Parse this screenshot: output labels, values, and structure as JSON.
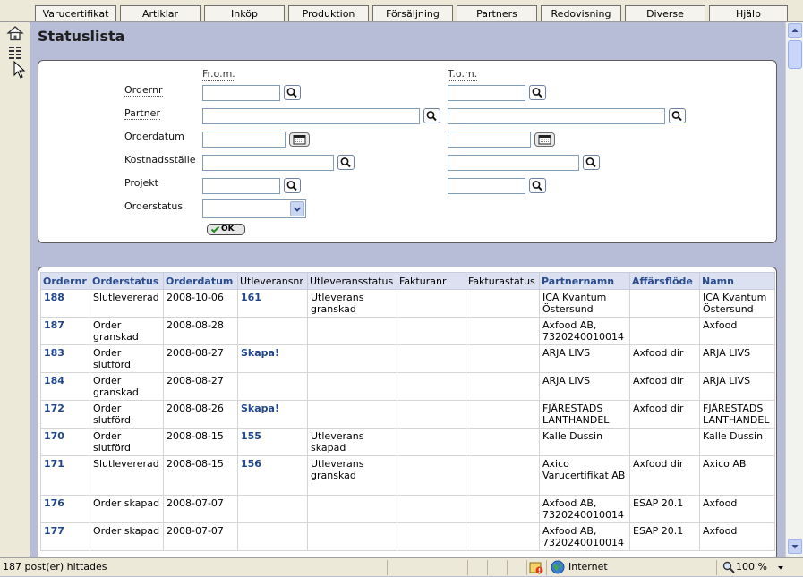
{
  "tabs": [
    "Varucertifikat",
    "Artiklar",
    "Inköp",
    "Produktion",
    "Försäljning",
    "Partners",
    "Redovisning",
    "Diverse",
    "Hjälp"
  ],
  "colors": {
    "background": "#b7bdd6",
    "link": "#21468c",
    "table_header": "#dbe1f1"
  },
  "left_icons": [
    "home-icon",
    "list-icon"
  ],
  "page_title": "Statuslista",
  "filter": {
    "from_label": "Fr.o.m.",
    "to_label": "T.o.m.",
    "labels": {
      "ordernr": "Ordernr",
      "partner": "Partner",
      "orderdatum": "Orderdatum",
      "kostnadsstalle": "Kostnadsställe",
      "projekt": "Projekt",
      "orderstatus": "Orderstatus"
    },
    "orderstatus_selected": "",
    "ok_label": "OK"
  },
  "table": {
    "headers": [
      "Ordernr",
      "Orderstatus",
      "Orderdatum",
      "Utleveransnr",
      "Utleveransstatus",
      "Fakturanr",
      "Fakturastatus",
      "Partnernamn",
      "Affärsflöde",
      "Namn"
    ],
    "rows": [
      [
        "188",
        "Slutlevererad",
        "2008-10-06",
        "161",
        "Utleverans granskad",
        "",
        "",
        "ICA Kvantum Östersund",
        "",
        "ICA Kvantum Östersund"
      ],
      [
        "187",
        "Order granskad",
        "2008-08-28",
        "",
        "",
        "",
        "",
        "Axfood AB, 7320240010014",
        "",
        "Axfood"
      ],
      [
        "183",
        "Order slutförd",
        "2008-08-27",
        "Skapa!",
        "",
        "",
        "",
        "ARJA LIVS",
        "Axfood dir",
        "ARJA LIVS"
      ],
      [
        "184",
        "Order granskad",
        "2008-08-27",
        "",
        "",
        "",
        "",
        "ARJA LIVS",
        "Axfood dir",
        "ARJA LIVS"
      ],
      [
        "172",
        "Order slutförd",
        "2008-08-26",
        "Skapa!",
        "",
        "",
        "",
        "FJÄRESTADS LANTHANDEL",
        "Axfood dir",
        "FJÄRESTADS LANTHANDEL"
      ],
      [
        "170",
        "Order slutförd",
        "2008-08-15",
        "155",
        "Utleverans skapad",
        "",
        "",
        "Kalle Dussin",
        "",
        "Kalle Dussin"
      ],
      [
        "171",
        "Slutlevererad",
        "2008-08-15",
        "156",
        "Utleverans granskad",
        "",
        "",
        "Axico Varucertifikat AB",
        "Axfood dir",
        "Axico AB"
      ],
      [
        "176",
        "Order skapad",
        "2008-07-07",
        "",
        "",
        "",
        "",
        "Axfood AB, 7320240010014",
        "ESAP 20.1",
        "Axfood"
      ],
      [
        "177",
        "Order skapad",
        "2008-07-07",
        "",
        "",
        "",
        "",
        "Axfood AB, 7320240010014",
        "ESAP 20.1",
        "Axfood"
      ]
    ]
  },
  "status": {
    "count_text": "187 post(er) hittades",
    "zone_text": "Internet",
    "zoom_text": "100 %"
  }
}
